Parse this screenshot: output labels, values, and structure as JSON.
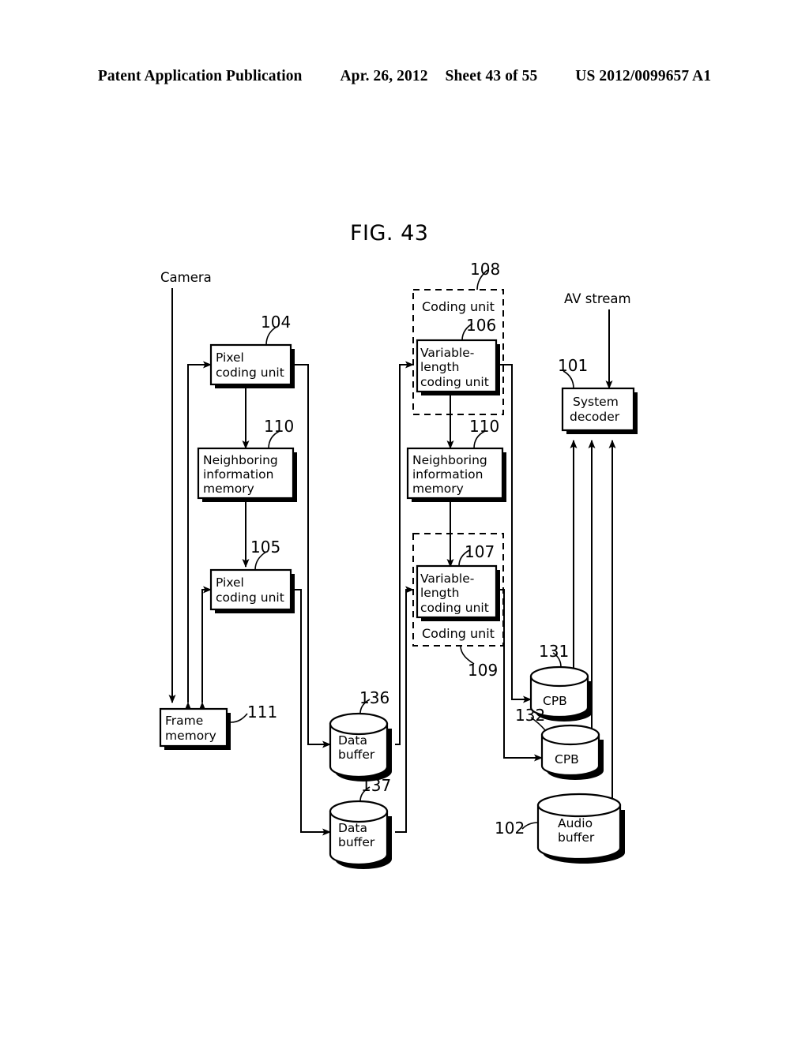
{
  "header": {
    "publication": "Patent Application Publication",
    "date": "Apr. 26, 2012",
    "sheet": "Sheet 43 of 55",
    "patent_number": "US 2012/0099657 A1"
  },
  "figure": {
    "title": "FIG. 43"
  },
  "free_labels": {
    "camera": "Camera",
    "av_stream": "AV stream"
  },
  "groups": [
    {
      "id": "108",
      "caption": "Coding unit",
      "ref": "108",
      "caption_pos": "top"
    },
    {
      "id": "109",
      "caption": "Coding unit",
      "ref": "109",
      "caption_pos": "bottom"
    }
  ],
  "blocks": {
    "pixel_coding_unit_104": {
      "ref": "104",
      "line1": "Pixel",
      "line2": "coding unit"
    },
    "pixel_coding_unit_105": {
      "ref": "105",
      "line1": "Pixel",
      "line2": "coding unit"
    },
    "neighboring_memory_left": {
      "ref": "110",
      "line1": "Neighboring",
      "line2": "information",
      "line3": "memory"
    },
    "neighboring_memory_right": {
      "ref": "110",
      "line1": "Neighboring",
      "line2": "information",
      "line3": "memory"
    },
    "vlc_unit_106": {
      "ref": "106",
      "line1": "Variable-",
      "line2": "length",
      "line3": "coding unit"
    },
    "vlc_unit_107": {
      "ref": "107",
      "line1": "Variable-",
      "line2": "length",
      "line3": "coding unit"
    },
    "frame_memory_111": {
      "ref": "111",
      "line1": "Frame",
      "line2": "memory"
    },
    "system_decoder_101": {
      "ref": "101",
      "line1": "System",
      "line2": "decoder"
    }
  },
  "cylinders": {
    "data_buffer_136": {
      "ref": "136",
      "line1": "Data",
      "line2": "buffer"
    },
    "data_buffer_137": {
      "ref": "137",
      "line1": "Data",
      "line2": "buffer"
    },
    "cpb_131": {
      "ref": "131",
      "line1": "CPB",
      "line2": ""
    },
    "cpb_132": {
      "ref": "132",
      "line1": "CPB",
      "line2": ""
    },
    "audio_buffer_102": {
      "ref": "102",
      "line1": "Audio",
      "line2": "buffer"
    }
  },
  "colors": {
    "ink": "#000000",
    "paper": "#ffffff"
  }
}
